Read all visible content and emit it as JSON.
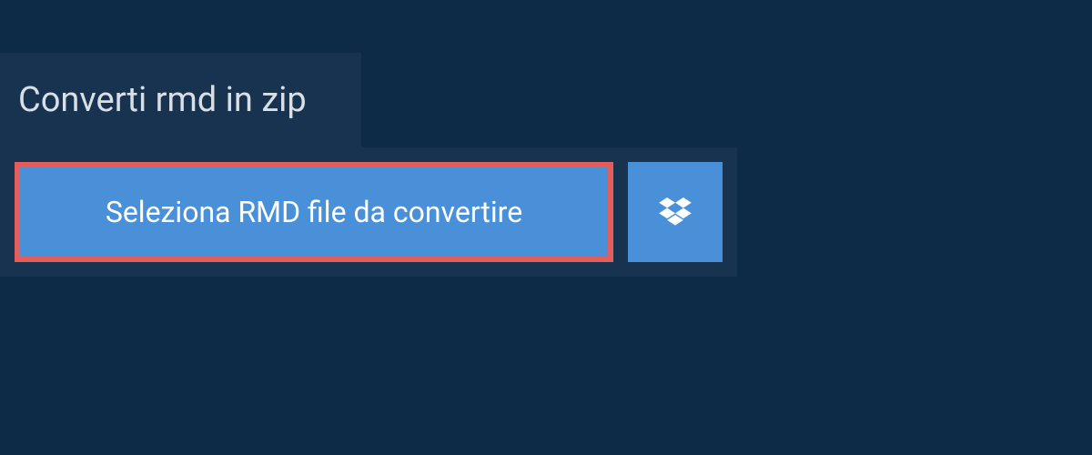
{
  "header": {
    "title": "Converti rmd in zip"
  },
  "upload": {
    "select_button_label": "Seleziona RMD file da convertire",
    "dropbox_icon_name": "dropbox-icon"
  }
}
